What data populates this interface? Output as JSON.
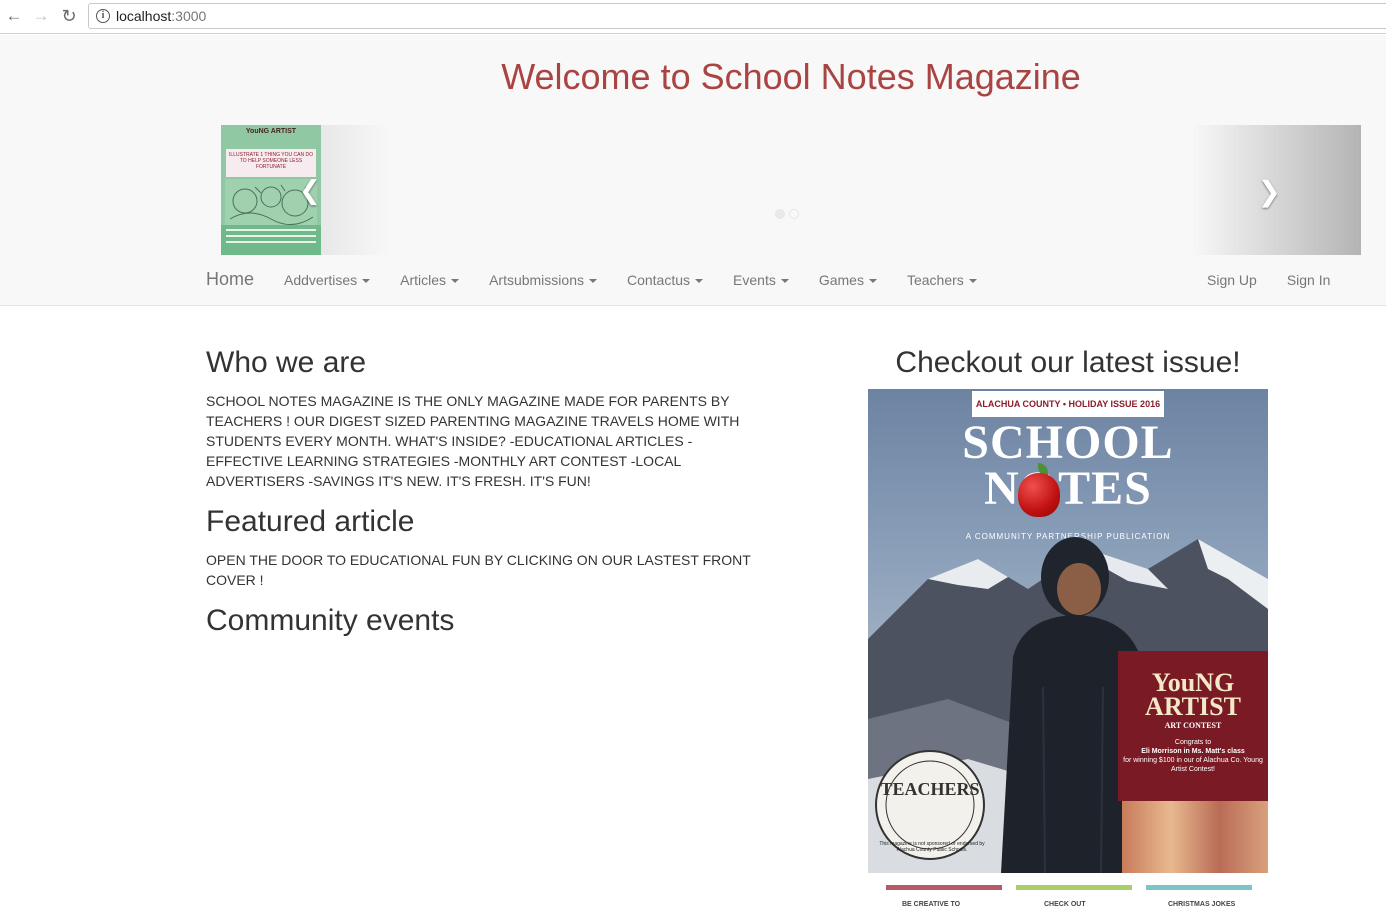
{
  "browser": {
    "url_host": "localhost",
    "url_port": ":3000"
  },
  "header": {
    "title": "Welcome to School Notes Magazine"
  },
  "carousel": {
    "thumb_title": "YouNG ARTIST",
    "thumb_subtitle": "ILLUSTRATE 1 THING YOU CAN DO TO HELP SOMEONE LESS FORTUNATE"
  },
  "navbar": {
    "brand": "Home",
    "items": [
      {
        "label": "Addvertises"
      },
      {
        "label": "Articles"
      },
      {
        "label": "Artsubmissions"
      },
      {
        "label": "Contactus"
      },
      {
        "label": "Events"
      },
      {
        "label": "Games"
      },
      {
        "label": "Teachers"
      }
    ],
    "sign_up": "Sign Up",
    "sign_in": "Sign In"
  },
  "main": {
    "who_heading": "Who we are",
    "who_text": "SCHOOL NOTES MAGAZINE IS THE ONLY MAGAZINE MADE FOR PARENTS BY TEACHERS ! OUR DIGEST SIZED PARENTING MAGAZINE TRAVELS HOME WITH STUDENTS EVERY MONTH. WHAT'S INSIDE? -EDUCATIONAL ARTICLES -EFFECTIVE LEARNING STRATEGIES -MONTHLY ART CONTEST -LOCAL ADVERTISERS -SAVINGS IT'S NEW. IT'S FRESH. IT'S FUN!",
    "featured_heading": "Featured article",
    "featured_text": "OPEN THE DOOR TO EDUCATIONAL FUN BY CLICKING ON OUR LASTEST FRONT COVER !",
    "events_heading": "Community events"
  },
  "issue": {
    "heading": "Checkout our latest issue!",
    "cover_label": "ALACHUA COUNTY • HOLIDAY ISSUE 2016",
    "cover_title_1": "SCHOOL",
    "cover_title_2": "NOTES",
    "cover_tagline": "A COMMUNITY PARTNERSHIP PUBLICATION",
    "contest_title": "YouNG ARTIST",
    "contest_sub": "ART CONTEST",
    "contest_congrats": "Congrats to",
    "contest_winner": "Eli Morrison in Ms. Matt's class",
    "contest_detail": "for winning $100 in our of Alachua Co. Young Artist Contest!",
    "stamp_text": "TEACHERS",
    "stamp_note": "This magazine is not sponsored or endorsed by Alachua County Public Schools.",
    "strip_items": [
      "BE CREATIVE TO",
      "CHECK OUT",
      "CHRISTMAS JOKES"
    ]
  },
  "colors": {
    "title": "#a94442",
    "nav_text": "#777777",
    "navbar_bg": "#f8f8f8"
  }
}
